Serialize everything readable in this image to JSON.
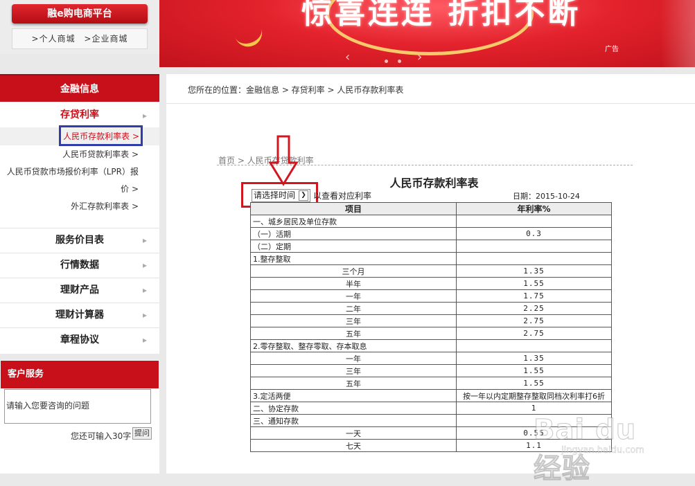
{
  "top": {
    "platform_label": "融e购电商平台",
    "mall_personal": ">个人商城",
    "mall_enterprise": ">企业商城"
  },
  "banner": {
    "slogan": "惊喜连连 折扣不断",
    "ad_label": "广告",
    "prev_icon": "chevron-left",
    "next_icon": "chevron-right"
  },
  "sidebar": {
    "header": "金融信息",
    "category": "存贷利率",
    "sub_items": [
      "人民币存款利率表 >",
      "人民币贷款利率表 >",
      "人民币贷款市场报价利率（LPR）报",
      "价 >",
      "外汇存款利率表 >"
    ],
    "menu": [
      "服务价目表",
      "行情数据",
      "理财产品",
      "理财计算器",
      "章程协议"
    ]
  },
  "customer_service": {
    "header": "客户服务",
    "input_placeholder": "请输入您要咨询的问题",
    "remaining": "您还可输入30字",
    "submit": "提问"
  },
  "main": {
    "location": "您所在的位置：金融信息 > 存贷利率 > 人民币存款利率表",
    "inner_breadcrumb": "首页 > 人民币存贷款利率",
    "title": "人民币存款利率表",
    "select_value": "请选择时间",
    "select_hint": "以查看对应利率",
    "date": "日期：2015-10-24",
    "columns": [
      "项目",
      "年利率%"
    ],
    "rows": [
      {
        "item": "一、城乡居民及单位存款",
        "rate": "",
        "align": "l"
      },
      {
        "item": "（一）活期",
        "rate": "0.3",
        "align": "l"
      },
      {
        "item": "（二）定期",
        "rate": "",
        "align": "l"
      },
      {
        "item": "1.整存整取",
        "rate": "",
        "align": "l"
      },
      {
        "item": "三个月",
        "rate": "1.35",
        "align": "c"
      },
      {
        "item": "半年",
        "rate": "1.55",
        "align": "c"
      },
      {
        "item": "一年",
        "rate": "1.75",
        "align": "c"
      },
      {
        "item": "二年",
        "rate": "2.25",
        "align": "c"
      },
      {
        "item": "三年",
        "rate": "2.75",
        "align": "c"
      },
      {
        "item": "五年",
        "rate": "2.75",
        "align": "c"
      },
      {
        "item": "2.零存整取、整存零取、存本取息",
        "rate": "",
        "align": "l"
      },
      {
        "item": "一年",
        "rate": "1.35",
        "align": "c"
      },
      {
        "item": "三年",
        "rate": "1.55",
        "align": "c"
      },
      {
        "item": "五年",
        "rate": "1.55",
        "align": "c"
      },
      {
        "item": "3.定活两便",
        "rate": "按一年以内定期整存整取同档次利率打6折",
        "align": "l"
      },
      {
        "item": "二、协定存款",
        "rate": "1",
        "align": "l"
      },
      {
        "item": "三、通知存款",
        "rate": "",
        "align": "l"
      },
      {
        "item": "一天",
        "rate": "0.55",
        "align": "c"
      },
      {
        "item": "七天",
        "rate": "1.1",
        "align": "c"
      }
    ]
  },
  "watermark": {
    "text": "Bai du 经验",
    "sub": "jingyan.baidu.com"
  },
  "colors": {
    "brand_red": "#c8101a",
    "annotation_blue": "#2f3da8",
    "annotation_red": "#d0161f"
  }
}
